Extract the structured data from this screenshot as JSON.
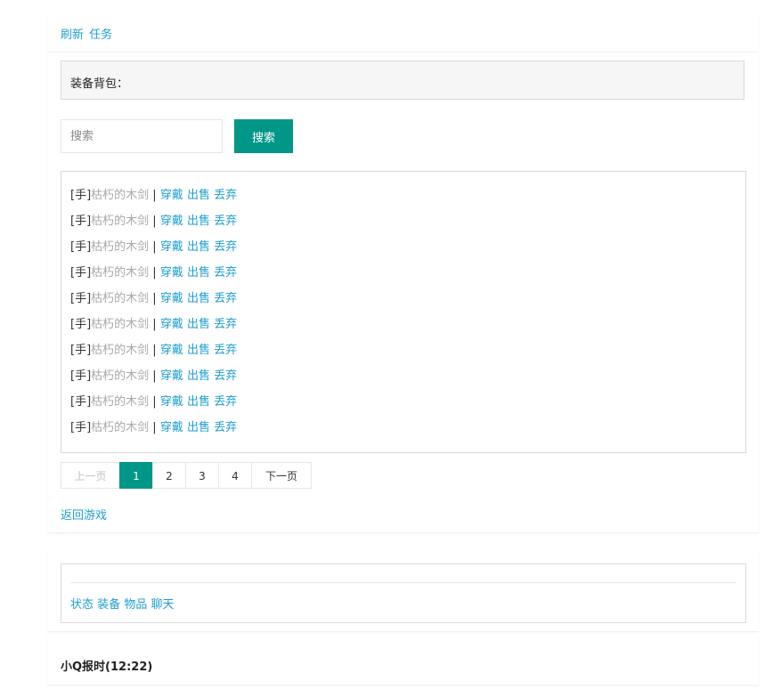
{
  "top_links": {
    "refresh": "刷新",
    "task": "任务"
  },
  "bag": {
    "title": "装备背包："
  },
  "search": {
    "placeholder": "搜索",
    "button": "搜索"
  },
  "items": [
    {
      "slot": "[手]",
      "name": "枯朽的木剑",
      "sep": " | ",
      "wear": "穿戴",
      "sell": "出售",
      "discard": "丢弃"
    },
    {
      "slot": "[手]",
      "name": "枯朽的木剑",
      "sep": " | ",
      "wear": "穿戴",
      "sell": "出售",
      "discard": "丢弃"
    },
    {
      "slot": "[手]",
      "name": "枯朽的木剑",
      "sep": " | ",
      "wear": "穿戴",
      "sell": "出售",
      "discard": "丢弃"
    },
    {
      "slot": "[手]",
      "name": "枯朽的木剑",
      "sep": " | ",
      "wear": "穿戴",
      "sell": "出售",
      "discard": "丢弃"
    },
    {
      "slot": "[手]",
      "name": "枯朽的木剑",
      "sep": " | ",
      "wear": "穿戴",
      "sell": "出售",
      "discard": "丢弃"
    },
    {
      "slot": "[手]",
      "name": "枯朽的木剑",
      "sep": " | ",
      "wear": "穿戴",
      "sell": "出售",
      "discard": "丢弃"
    },
    {
      "slot": "[手]",
      "name": "枯朽的木剑",
      "sep": " | ",
      "wear": "穿戴",
      "sell": "出售",
      "discard": "丢弃"
    },
    {
      "slot": "[手]",
      "name": "枯朽的木剑",
      "sep": " | ",
      "wear": "穿戴",
      "sell": "出售",
      "discard": "丢弃"
    },
    {
      "slot": "[手]",
      "name": "枯朽的木剑",
      "sep": " | ",
      "wear": "穿戴",
      "sell": "出售",
      "discard": "丢弃"
    },
    {
      "slot": "[手]",
      "name": "枯朽的木剑",
      "sep": " | ",
      "wear": "穿戴",
      "sell": "出售",
      "discard": "丢弃"
    }
  ],
  "pagination": {
    "prev": "上一页",
    "pages": [
      "1",
      "2",
      "3",
      "4"
    ],
    "current": "1",
    "next": "下一页"
  },
  "back": "返回游戏",
  "nav": {
    "status": "状态",
    "equip": "装备",
    "goods": "物品",
    "chat": "聊天"
  },
  "report": "小Q报时(12:22)",
  "colors": {
    "accent": "#009688",
    "link": "#1e9fcf",
    "item_name": "#a8a8a8"
  }
}
